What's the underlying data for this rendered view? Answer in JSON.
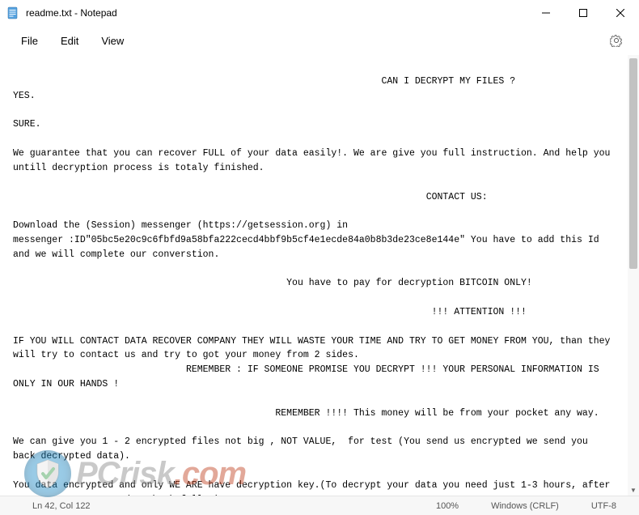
{
  "titlebar": {
    "icon_name": "notepad-app-icon",
    "title": "readme.txt - Notepad"
  },
  "menu": {
    "file": "File",
    "edit": "Edit",
    "view": "View"
  },
  "editor": {
    "content": "                                                                  CAN I DECRYPT MY FILES ?\nYES.\n\nSURE.\n\nWe guarantee that you can recover FULL of your data easily!. We are give you full instruction. And help you untill decryption process is totaly finished.\n\n                                                                          CONTACT US:\n\nDownload the (Session) messenger (https://getsession.org) in\nmessenger :ID\"05bc5e20c9c6fbfd9a58bfa222cecd4bbf9b5cf4e1ecde84a0b8b3de23ce8e144e\" You have to add this Id and we will complete our converstion.\n\n                                                 You have to pay for decryption BITCOIN ONLY!\n\n                                                                           !!! ATTENTION !!!\n\nIF YOU WILL CONTACT DATA RECOVER COMPANY THEY WILL WASTE YOUR TIME AND TRY TO GET MONEY FROM YOU, than they will try to contact us and try to got your money from 2 sides.\n                               REMEMBER : IF SOMEONE PROMISE YOU DECRYPT !!! YOUR PERSONAL INFORMATION IS ONLY IN OUR HANDS !\n\n                                               REMEMBER !!!! This money will be from your pocket any way.\n\nWe can give you 1 - 2 encrypted files not big , NOT VALUE,  for test (You send us encrypted we send you back decrypted data).\n\nYou data encrypted and only WE ARE have decryption key.(To decrypt your data you need just 1-3 hours, after payment to got your data back fully )\n\nDo not rename encrypted files, do not try to decrypt your data by using third party software, it may permanent data loss."
  },
  "statusbar": {
    "position": "Ln 42, Col 122",
    "zoom": "100%",
    "line_ending": "Windows (CRLF)",
    "encoding": "UTF-8"
  },
  "watermark": {
    "brand": "PCrisk",
    "suffix": ".com"
  }
}
